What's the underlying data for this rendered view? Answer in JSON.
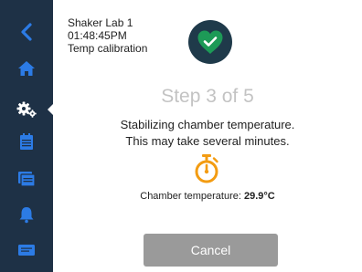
{
  "header": {
    "device_name": "Shaker Lab 1",
    "time": "01:48:45PM",
    "process": "Temp calibration"
  },
  "main": {
    "step_label": "Step 3 of 5",
    "message_line1": "Stabilizing chamber temperature.",
    "message_line2": "This may take several minutes.",
    "temp_label": "Chamber temperature: ",
    "temp_value": "29.9°C",
    "cancel_label": "Cancel"
  },
  "sidebar": {
    "items": [
      "back-icon",
      "home-icon",
      "settings-icon",
      "calendar-icon",
      "list-icon",
      "alarm-icon",
      "message-icon"
    ],
    "active": "settings-icon"
  },
  "colors": {
    "sidebar": "#1e3146",
    "accent": "#2c7be5",
    "status_green": "#1d9a57",
    "timer_orange": "#f39c12",
    "button_gray": "#9a9a9a"
  }
}
